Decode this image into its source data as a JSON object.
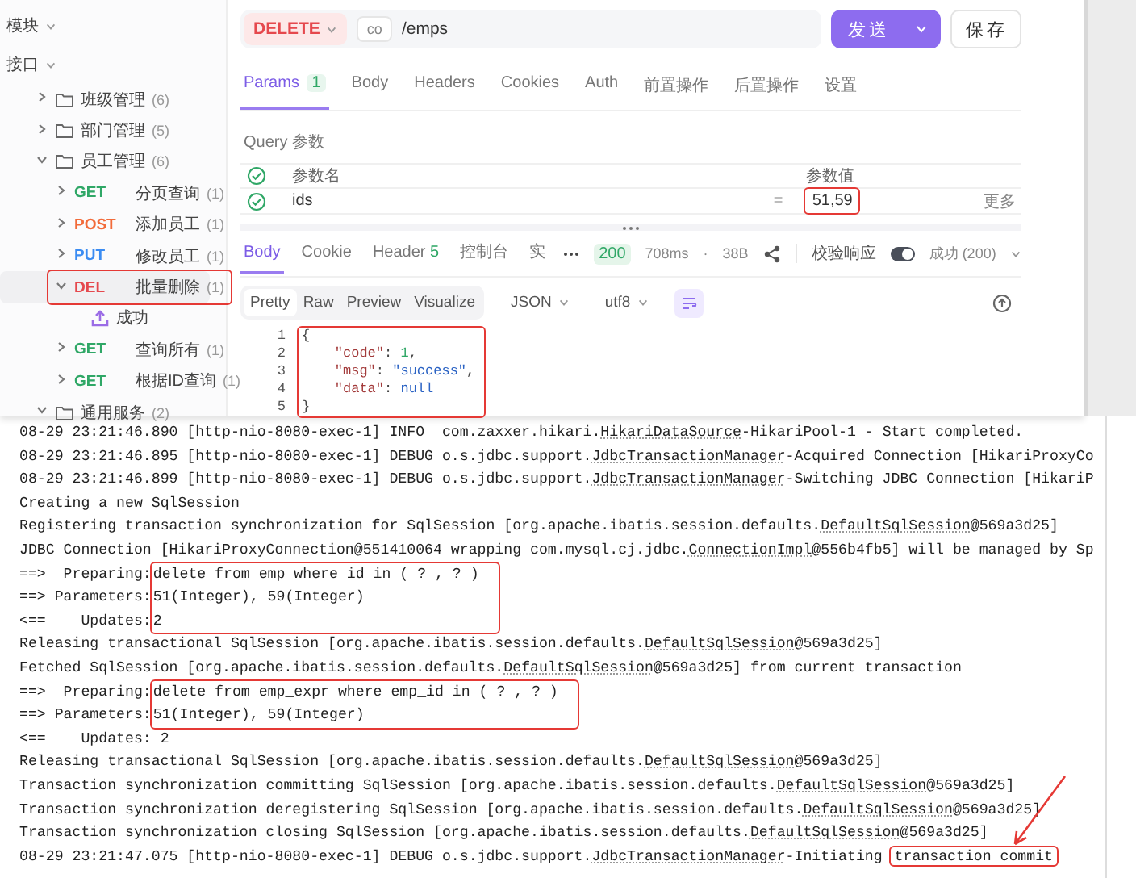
{
  "sidebar": {
    "items": [
      {
        "kind": "section",
        "label": "模块"
      },
      {
        "kind": "section",
        "label": "接口",
        "children": [
          {
            "kind": "folder",
            "label": "班级管理",
            "count": "(6)",
            "expanded": false
          },
          {
            "kind": "folder",
            "label": "部门管理",
            "count": "(5)",
            "expanded": false
          },
          {
            "kind": "folder",
            "label": "员工管理",
            "count": "(6)",
            "expanded": true,
            "children": [
              {
                "kind": "endpoint",
                "method": "GET",
                "color": "#2fa766",
                "label": "分页查询",
                "count": "(1)",
                "expanded": false,
                "selected": false,
                "highlighted": false
              },
              {
                "kind": "endpoint",
                "method": "POST",
                "color": "#f26b3a",
                "label": "添加员工",
                "count": "(1)",
                "expanded": false,
                "selected": false,
                "highlighted": false
              },
              {
                "kind": "endpoint",
                "method": "PUT",
                "color": "#3b8cf2",
                "label": "修改员工",
                "count": "(1)",
                "expanded": false,
                "selected": false,
                "highlighted": false
              },
              {
                "kind": "endpoint",
                "method": "DEL",
                "color": "#e5484d",
                "label": "批量删除",
                "count": "(1)",
                "expanded": true,
                "selected": true,
                "highlighted": true,
                "children": [
                  {
                    "kind": "example",
                    "label": "成功"
                  }
                ]
              },
              {
                "kind": "endpoint",
                "method": "GET",
                "color": "#2fa766",
                "label": "查询所有",
                "count": "(1)",
                "expanded": false,
                "selected": false,
                "highlighted": false
              },
              {
                "kind": "endpoint",
                "method": "GET",
                "color": "#2fa766",
                "label": "根据ID查询",
                "count": "(1)",
                "expanded": false,
                "selected": false,
                "highlighted": false
              }
            ]
          },
          {
            "kind": "folder",
            "label": "通用服务",
            "count": "(2)",
            "expanded": true
          }
        ]
      }
    ]
  },
  "request": {
    "method": "DELETE",
    "env": "co",
    "url": "/emps",
    "send": "发送",
    "save": "保存"
  },
  "tabs": [
    {
      "label": "Params",
      "count": "1",
      "selected": true
    },
    {
      "label": "Body",
      "selected": false
    },
    {
      "label": "Headers",
      "selected": false
    },
    {
      "label": "Cookies",
      "selected": false
    },
    {
      "label": "Auth",
      "selected": false
    },
    {
      "label": "前置操作",
      "selected": false
    },
    {
      "label": "后置操作",
      "selected": false
    },
    {
      "label": "设置",
      "selected": false
    }
  ],
  "query": {
    "title": "Query 参数",
    "header_checked": true,
    "columns": [
      "参数名",
      "参数值"
    ],
    "rows": [
      {
        "checked": true,
        "name": "ids",
        "operator": "=",
        "value": "51,59",
        "highlighted": true,
        "more": "更多"
      }
    ]
  },
  "response": {
    "tabs": [
      {
        "label": "Body",
        "selected": true
      },
      {
        "label": "Cookie",
        "selected": false
      },
      {
        "label": "Header",
        "count": "5",
        "selected": false
      },
      {
        "label": "控制台",
        "selected": false
      },
      {
        "label": "实",
        "selected": false
      }
    ],
    "status": "200",
    "time": "708ms",
    "separator": "·",
    "size": "38B",
    "validate": {
      "label": "校验响应",
      "on": true
    },
    "result": "成功 (200)",
    "formats": [
      {
        "label": "Pretty",
        "selected": true
      },
      {
        "label": "Raw",
        "selected": false
      },
      {
        "label": "Preview",
        "selected": false
      },
      {
        "label": "Visualize",
        "selected": false
      }
    ],
    "type": "JSON",
    "encoding": "utf8",
    "code": {
      "highlighted": true,
      "lines": [
        {
          "number": "1",
          "parts": [
            {
              "text": "{",
              "kind": "punct"
            }
          ]
        },
        {
          "number": "2",
          "parts": [
            {
              "text": "    \"code\"",
              "kind": "key"
            },
            {
              "text": ": ",
              "kind": "punct"
            },
            {
              "text": "1",
              "kind": "number"
            },
            {
              "text": ",",
              "kind": "punct"
            }
          ]
        },
        {
          "number": "3",
          "parts": [
            {
              "text": "    \"msg\"",
              "kind": "key"
            },
            {
              "text": ": ",
              "kind": "punct"
            },
            {
              "text": "\"success\"",
              "kind": "string"
            },
            {
              "text": ",",
              "kind": "punct"
            }
          ]
        },
        {
          "number": "4",
          "parts": [
            {
              "text": "    \"data\"",
              "kind": "key"
            },
            {
              "text": ": ",
              "kind": "punct"
            },
            {
              "text": "null",
              "kind": "null"
            }
          ]
        },
        {
          "number": "5",
          "parts": [
            {
              "text": "}",
              "kind": "punct"
            }
          ]
        }
      ]
    }
  },
  "log": [
    {
      "kind": "line",
      "parts": [
        {
          "kind": "text",
          "text": "08-29 23:21:46.890 [http-nio-8080-exec-1] INFO  com.zaxxer.hikari."
        },
        {
          "kind": "class_ref",
          "text": "HikariDataSource"
        },
        {
          "kind": "text",
          "text": "-HikariPool-1 - Start completed."
        }
      ]
    },
    {
      "kind": "line",
      "parts": [
        {
          "kind": "text",
          "text": "08-29 23:21:46.895 [http-nio-8080-exec-1] DEBUG o.s.jdbc.support."
        },
        {
          "kind": "class_ref",
          "text": "JdbcTransactionManager"
        },
        {
          "kind": "text",
          "text": "-Acquired Connection [HikariProxyCo"
        }
      ]
    },
    {
      "kind": "line",
      "parts": [
        {
          "kind": "text",
          "text": "08-29 23:21:46.899 [http-nio-8080-exec-1] DEBUG o.s.jdbc.support."
        },
        {
          "kind": "class_ref",
          "text": "JdbcTransactionManager"
        },
        {
          "kind": "text",
          "text": "-Switching JDBC Connection [HikariP"
        }
      ]
    },
    {
      "kind": "line",
      "parts": [
        {
          "kind": "text",
          "text": "Creating a new SqlSession"
        }
      ]
    },
    {
      "kind": "line",
      "parts": [
        {
          "kind": "text",
          "text": "Registering transaction synchronization for SqlSession [org.apache.ibatis.session.defaults."
        },
        {
          "kind": "class_ref",
          "text": "DefaultSqlSession"
        },
        {
          "kind": "text",
          "text": "@569a3d25]"
        }
      ]
    },
    {
      "kind": "line",
      "parts": [
        {
          "kind": "text",
          "text": "JDBC Connection [HikariProxyConnection@551410064 wrapping com.mysql.cj.jdbc."
        },
        {
          "kind": "class_ref",
          "text": "ConnectionImpl"
        },
        {
          "kind": "text",
          "text": "@556b4fb5] will be managed by Sp"
        }
      ]
    },
    {
      "kind": "sql",
      "highlighted": true,
      "rows": [
        {
          "label": "==>  Preparing:",
          "value": "delete from emp where id in ( ? , ? )"
        },
        {
          "label": "==> Parameters:",
          "value": "51(Integer), 59(Integer)"
        },
        {
          "label": "<==    Updates:",
          "value": "2"
        }
      ]
    },
    {
      "kind": "line",
      "parts": [
        {
          "kind": "text",
          "text": "Releasing transactional SqlSession [org.apache.ibatis.session.defaults."
        },
        {
          "kind": "class_ref",
          "text": "DefaultSqlSession"
        },
        {
          "kind": "text",
          "text": "@569a3d25]"
        }
      ]
    },
    {
      "kind": "line",
      "parts": [
        {
          "kind": "text",
          "text": "Fetched SqlSession [org.apache.ibatis.session.defaults."
        },
        {
          "kind": "class_ref",
          "text": "DefaultSqlSession"
        },
        {
          "kind": "text",
          "text": "@569a3d25] from current transaction"
        }
      ]
    },
    {
      "kind": "sql",
      "highlighted": true,
      "rows": [
        {
          "label": "==>  Preparing:",
          "value": "delete from emp_expr where emp_id in ( ? , ? )"
        },
        {
          "label": "==> Parameters:",
          "value": "51(Integer), 59(Integer)"
        }
      ]
    },
    {
      "kind": "line",
      "parts": [
        {
          "kind": "text",
          "text": "<==    Updates: 2"
        }
      ]
    },
    {
      "kind": "line",
      "parts": [
        {
          "kind": "text",
          "text": "Releasing transactional SqlSession [org.apache.ibatis.session.defaults."
        },
        {
          "kind": "class_ref",
          "text": "DefaultSqlSession"
        },
        {
          "kind": "text",
          "text": "@569a3d25]"
        }
      ]
    },
    {
      "kind": "line",
      "parts": [
        {
          "kind": "text",
          "text": "Transaction synchronization committing SqlSession [org.apache.ibatis.session.defaults."
        },
        {
          "kind": "class_ref",
          "text": "DefaultSqlSession"
        },
        {
          "kind": "text",
          "text": "@569a3d25]"
        }
      ]
    },
    {
      "kind": "line",
      "parts": [
        {
          "kind": "text",
          "text": "Transaction synchronization deregistering SqlSession [org.apache.ibatis.session.defaults."
        },
        {
          "kind": "class_ref",
          "text": "DefaultSqlSession"
        },
        {
          "kind": "text",
          "text": "@569a3d25]"
        }
      ]
    },
    {
      "kind": "line",
      "parts": [
        {
          "kind": "text",
          "text": "Transaction synchronization closing SqlSession [org.apache.ibatis.session.defaults."
        },
        {
          "kind": "class_ref",
          "text": "DefaultSqlSession"
        },
        {
          "kind": "text",
          "text": "@569a3d25]"
        }
      ]
    },
    {
      "kind": "line",
      "parts": [
        {
          "kind": "text",
          "text": "08-29 23:21:47.075 [http-nio-8080-exec-1] DEBUG o.s.jdbc.support."
        },
        {
          "kind": "class_ref",
          "text": "JdbcTransactionManager"
        },
        {
          "kind": "text",
          "text": "-Initiating "
        },
        {
          "kind": "text",
          "text": "transaction commit",
          "highlighted": true
        }
      ]
    }
  ]
}
